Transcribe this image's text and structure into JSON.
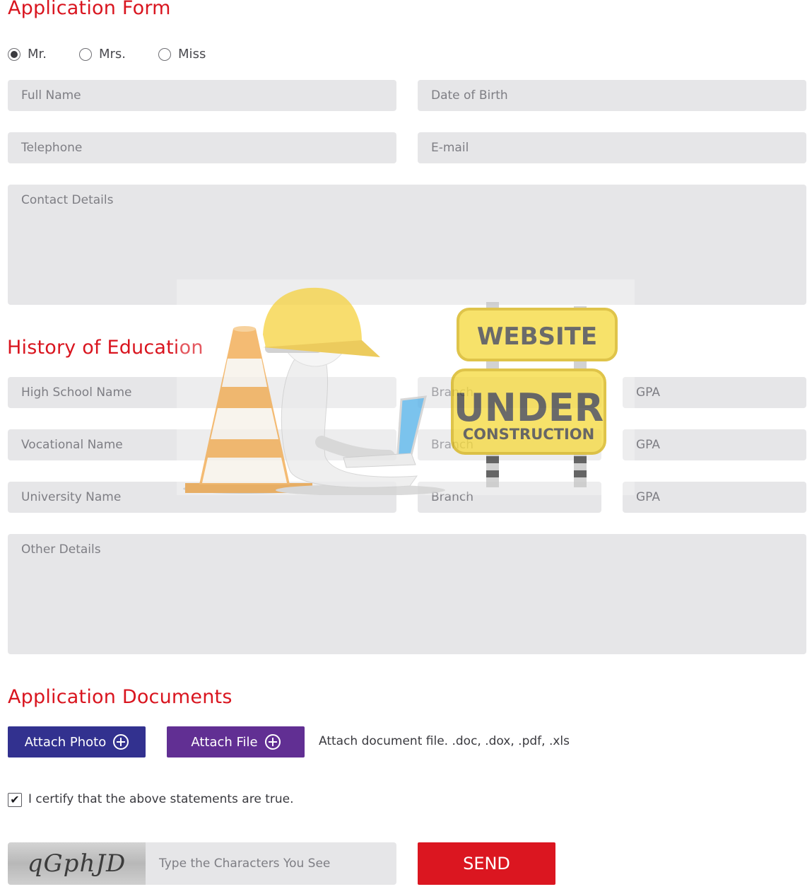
{
  "form": {
    "title": "Application Form",
    "salutations": {
      "mr": "Mr.",
      "mrs": "Mrs.",
      "miss": "Miss",
      "selected": "Mr."
    },
    "full_name_placeholder": "Full Name",
    "dob_placeholder": "Date of Birth",
    "telephone_placeholder": "Telephone",
    "email_placeholder": "E-mail",
    "contact_placeholder": "Contact Details"
  },
  "education": {
    "title": "History of Education",
    "high_school": {
      "name": "High School Name",
      "branch": "Branch",
      "gpa": "GPA"
    },
    "vocational": {
      "name": "Vocational Name",
      "branch": "Branch",
      "gpa": "GPA"
    },
    "university": {
      "name": "University Name",
      "branch": "Branch",
      "gpa": "GPA"
    },
    "other_placeholder": "Other Details"
  },
  "documents": {
    "title": "Application Documents",
    "attach_photo_label": "Attach Photo",
    "attach_file_label": "Attach File",
    "hint": "Attach document file. .doc, .dox, .pdf, .xls"
  },
  "certify": {
    "checked": true,
    "label": "I certify that the above statements are true."
  },
  "captcha": {
    "code": "qGphJD",
    "placeholder": "Type the Characters You See"
  },
  "send_label": "SEND",
  "overlay": {
    "sign_line1": "WEBSITE",
    "sign_line2": "UNDER",
    "sign_line3": "CONSTRUCTION"
  },
  "colors": {
    "accent_red": "#d9151f",
    "attach_photo_bg": "#32318f",
    "attach_file_bg": "#612f93",
    "send_bg": "#db1620",
    "field_bg": "#e6e6e8"
  }
}
